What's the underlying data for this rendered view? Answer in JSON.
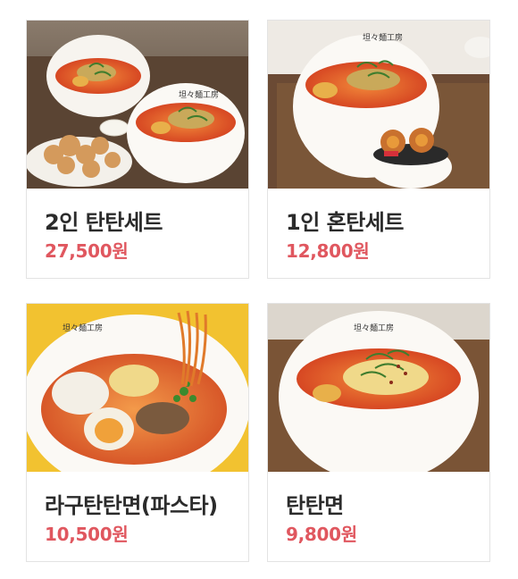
{
  "menu": {
    "items": [
      {
        "name": "2인 탄탄세트",
        "price": "27,500원",
        "image_icon": "tantan-set-for-two-photo"
      },
      {
        "name": "1인 혼탄세트",
        "price": "12,800원",
        "image_icon": "tantan-set-for-one-photo"
      },
      {
        "name": "라구탄탄면(파스타)",
        "price": "10,500원",
        "image_icon": "ragu-tantan-pasta-photo"
      },
      {
        "name": "탄탄면",
        "price": "9,800원",
        "image_icon": "tantanmen-photo"
      }
    ]
  },
  "colors": {
    "price": "#e0575f",
    "name": "#2b2b2b",
    "border": "#e3e3e3"
  }
}
